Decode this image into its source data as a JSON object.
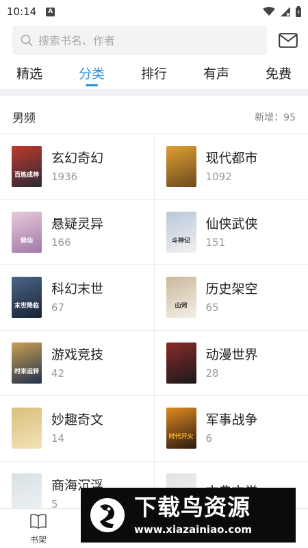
{
  "status_bar": {
    "time": "10:14",
    "notification_glyph": "A"
  },
  "search": {
    "placeholder": "搜索书名、作者"
  },
  "tabs": [
    {
      "label": "精选",
      "active": false
    },
    {
      "label": "分类",
      "active": true
    },
    {
      "label": "排行",
      "active": false
    },
    {
      "label": "有声",
      "active": false
    },
    {
      "label": "免费",
      "active": false
    }
  ],
  "section": {
    "title": "男频",
    "new_count": "新增：95"
  },
  "categories": [
    {
      "name": "玄幻奇幻",
      "count": "1936",
      "cover_colors": [
        "#2a2a35",
        "#c0392b"
      ],
      "cover_text": "百炼成神"
    },
    {
      "name": "现代都市",
      "count": "1092",
      "cover_colors": [
        "#6b4a1f",
        "#e0a030"
      ],
      "cover_text": ""
    },
    {
      "name": "悬疑灵异",
      "count": "166",
      "cover_colors": [
        "#a07aa8",
        "#e8c9d9"
      ],
      "cover_text": "修仙"
    },
    {
      "name": "仙侠武侠",
      "count": "151",
      "cover_colors": [
        "#f1f1f1",
        "#b9c7d8"
      ],
      "cover_text": "斗神记"
    },
    {
      "name": "科幻末世",
      "count": "67",
      "cover_colors": [
        "#1a2233",
        "#4a6688"
      ],
      "cover_text": "末世降临"
    },
    {
      "name": "历史架空",
      "count": "65",
      "cover_colors": [
        "#f4f0e8",
        "#c9b89a"
      ],
      "cover_text": "山河"
    },
    {
      "name": "游戏竞技",
      "count": "42",
      "cover_colors": [
        "#20314f",
        "#c9a050"
      ],
      "cover_text": "时来运转"
    },
    {
      "name": "动漫世界",
      "count": "28",
      "cover_colors": [
        "#1a1a1a",
        "#8a2a2a"
      ],
      "cover_text": ""
    },
    {
      "name": "妙趣奇文",
      "count": "14",
      "cover_colors": [
        "#f2e2b8",
        "#d9bf7a"
      ],
      "cover_text": ""
    },
    {
      "name": "军事战争",
      "count": "6",
      "cover_colors": [
        "#2a1a10",
        "#e08a20"
      ],
      "cover_text": "时代开火"
    },
    {
      "name": "商海沉浮",
      "count": "5",
      "cover_colors": [
        "#eef2f4",
        "#d9e1e6"
      ],
      "cover_text": ""
    },
    {
      "name": "古典文学",
      "count": "",
      "cover_colors": [
        "#f6f6f6",
        "#e2e2e2"
      ],
      "cover_text": ""
    }
  ],
  "bottom_nav": {
    "bookshelf_label": "书架"
  },
  "watermark": {
    "main": "下载鸟资源",
    "url": "www.xiazainiao.com"
  },
  "colors": {
    "accent": "#2a8fde",
    "divider": "#ececec",
    "muted": "#999999"
  },
  "icons": [
    "search-icon",
    "mail-icon",
    "wifi-icon",
    "signal-icon",
    "battery-icon",
    "book-icon"
  ]
}
